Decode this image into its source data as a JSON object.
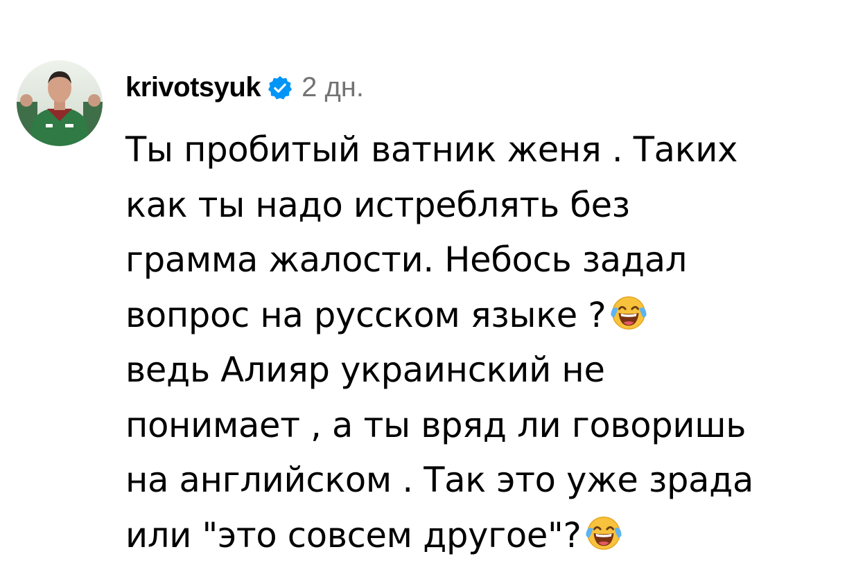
{
  "comment": {
    "username": "krivotsyuk",
    "time": "2 дн.",
    "avatar_icon": "user-avatar-icon",
    "verified_icon": "verified-badge-icon",
    "emoji_icon": "face-with-tears-of-joy-icon",
    "verified_color": "#0095F6",
    "lines": [
      "Ты пробитый ватник женя . Таких",
      "как ты надо истреблять без",
      "грамма жалости. Небось задал",
      "вопрос на русском языке ?",
      "ведь Алияр украинский не",
      "понимает , а ты вряд ли говоришь",
      "на английском . Так это уже зрада",
      "или \"это совсем другое\"?"
    ]
  }
}
